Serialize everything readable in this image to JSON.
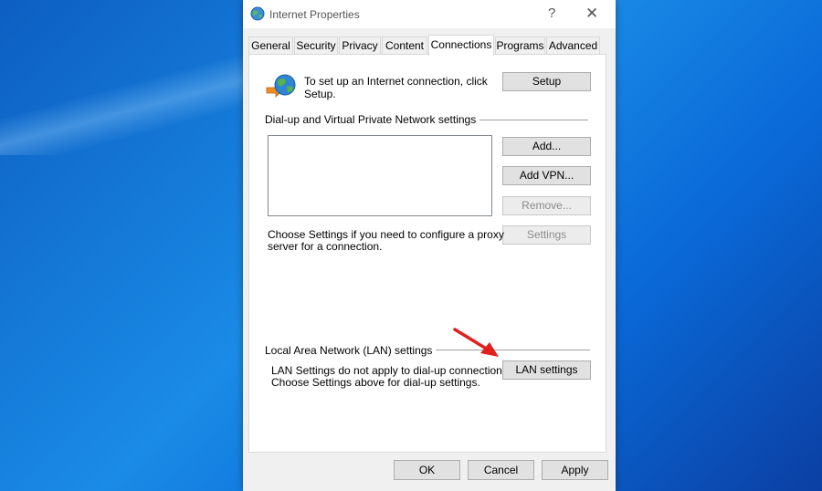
{
  "window": {
    "title": "Internet Properties",
    "help_glyph": "?",
    "close_glyph": "✕"
  },
  "tabs": [
    {
      "label": "General",
      "active": false
    },
    {
      "label": "Security",
      "active": false
    },
    {
      "label": "Privacy",
      "active": false
    },
    {
      "label": "Content",
      "active": false
    },
    {
      "label": "Connections",
      "active": true
    },
    {
      "label": "Programs",
      "active": false
    },
    {
      "label": "Advanced",
      "active": false
    }
  ],
  "setup": {
    "text_line1": "To set up an Internet connection, click",
    "text_line2": "Setup.",
    "button": "Setup"
  },
  "dialup": {
    "group_label": "Dial-up and Virtual Private Network settings",
    "add_button": "Add...",
    "add_vpn_button": "Add VPN...",
    "remove_button": "Remove...",
    "settings_button": "Settings",
    "proxy_text_line1": "Choose Settings if you need to configure a proxy",
    "proxy_text_line2": "server for a connection."
  },
  "lan": {
    "group_label": "Local Area Network (LAN) settings",
    "text_line1": "LAN Settings do not apply to dial-up connections.",
    "text_line2": "Choose Settings above for dial-up settings.",
    "button": "LAN settings"
  },
  "footer": {
    "ok": "OK",
    "cancel": "Cancel",
    "apply": "Apply"
  },
  "colors": {
    "annotation_arrow": "#e0201c",
    "desktop_blue": "#1a8be6"
  }
}
